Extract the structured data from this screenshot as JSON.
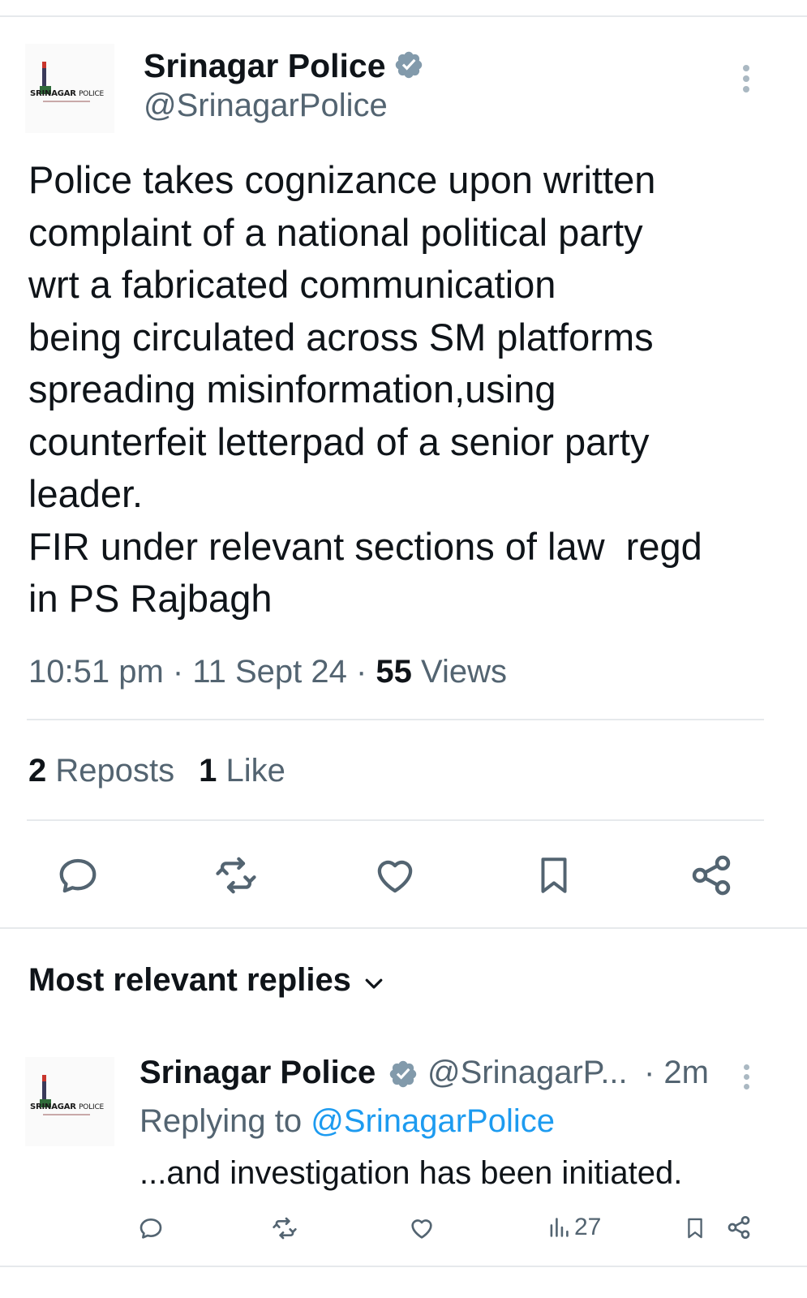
{
  "tweet": {
    "author_name": "Srinagar Police",
    "author_handle": "@SrinagarPolice",
    "avatar_text_bold": "SRINAGAR",
    "avatar_text_light": "POLICE",
    "body_lines": [
      "Police takes cognizance upon written",
      "complaint of a national political party",
      "wrt a fabricated communication",
      "being circulated across SM platforms",
      "spreading misinformation,using",
      "counterfeit letterpad of a senior party",
      "leader.",
      "FIR under relevant sections of law  regd",
      "in PS Rajbagh"
    ],
    "time": "10:51 pm",
    "date": "11 Sept 24",
    "views_count": "55",
    "views_label": "Views",
    "reposts_count": "2",
    "reposts_label": "Reposts",
    "likes_count": "1",
    "likes_label": "Like"
  },
  "replies_section": {
    "title": "Most relevant replies"
  },
  "reply": {
    "author_name": "Srinagar Police",
    "author_handle": "@SrinagarP...",
    "time_ago": "· 2m",
    "replying_to_prefix": "Replying to ",
    "replying_to_handle": "@SrinagarPolice",
    "text": "...and investigation has been initiated.",
    "views_count": "27"
  },
  "colors": {
    "text_primary": "#0f1419",
    "text_secondary": "#536471",
    "link": "#1d9bf0",
    "verified_badge": "#829aab",
    "icon": "#536471",
    "divider": "#e6e9ec"
  },
  "icons": {
    "verified": "verified-badge-icon",
    "more": "more-vertical-icon",
    "reply": "reply-icon",
    "repost": "repost-icon",
    "like": "heart-icon",
    "bookmark": "bookmark-icon",
    "share": "share-icon",
    "views": "views-chart-icon",
    "chevron": "chevron-down-icon"
  }
}
